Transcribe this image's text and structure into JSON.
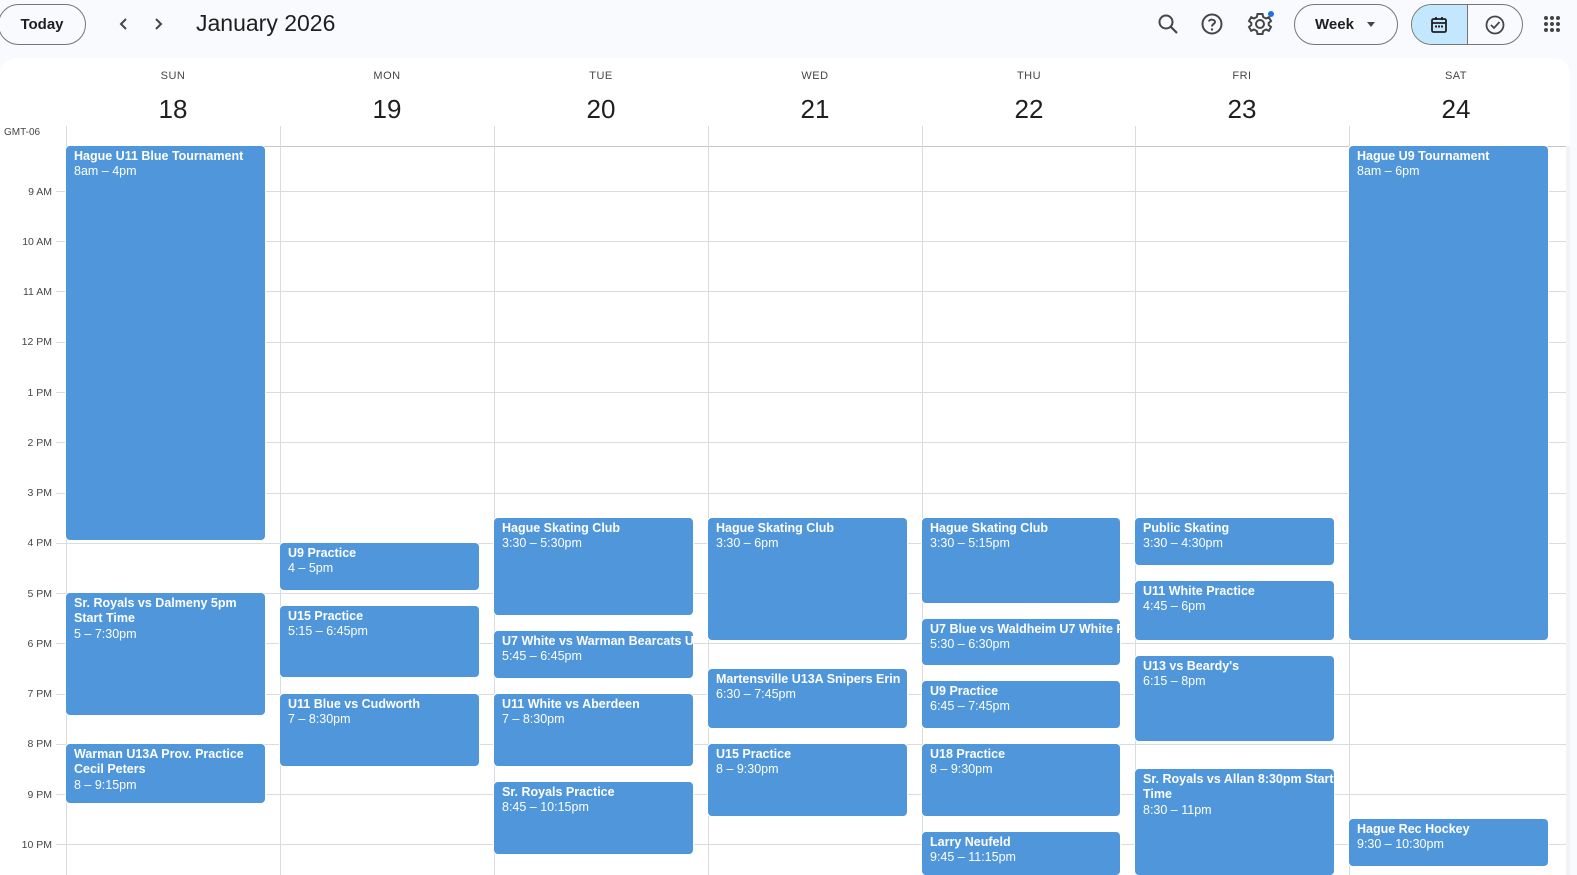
{
  "header": {
    "today_label": "Today",
    "title": "January 2026",
    "view_label": "Week",
    "icons": {
      "prev": "chevron-left-icon",
      "next": "chevron-right-icon",
      "search": "search-icon",
      "help": "help-icon",
      "settings": "gear-icon",
      "calendar": "calendar-icon",
      "tasks": "task-check-icon",
      "apps": "apps-grid-icon"
    }
  },
  "calendar": {
    "timezone": "GMT-06",
    "days": [
      {
        "dow": "SUN",
        "date": "18"
      },
      {
        "dow": "MON",
        "date": "19"
      },
      {
        "dow": "TUE",
        "date": "20"
      },
      {
        "dow": "WED",
        "date": "21"
      },
      {
        "dow": "THU",
        "date": "22"
      },
      {
        "dow": "FRI",
        "date": "23"
      },
      {
        "dow": "SAT",
        "date": "24"
      }
    ],
    "hours": [
      "9 AM",
      "10 AM",
      "11 AM",
      "12 PM",
      "1 PM",
      "2 PM",
      "3 PM",
      "4 PM",
      "5 PM",
      "6 PM",
      "7 PM",
      "8 PM",
      "9 PM",
      "10 PM"
    ],
    "event_color": "#4f96db",
    "events": [
      {
        "title": "Hague U11 Blue Tournament",
        "time": "8am – 4pm"
      },
      {
        "title": "Sr. Royals vs Dalmeny 5pm Start Time",
        "time": "5 – 7:30pm"
      },
      {
        "title": "Warman U13A Prov. Practice Cecil Peters",
        "time": "8 – 9:15pm"
      },
      {
        "title": "U9 Practice",
        "time": "4 – 5pm"
      },
      {
        "title": "U15 Practice",
        "time": "5:15 – 6:45pm"
      },
      {
        "title": "U11 Blue vs Cudworth",
        "time": "7 – 8:30pm"
      },
      {
        "title": "Hague Skating Club",
        "time": "3:30 – 5:30pm"
      },
      {
        "title": "U7 White vs Warman Bearcats U",
        "time": "5:45 – 6:45pm"
      },
      {
        "title": "U11 White vs Aberdeen",
        "time": "7 – 8:30pm"
      },
      {
        "title": "Sr. Royals Practice",
        "time": "8:45 – 10:15pm"
      },
      {
        "title": "Hague Skating Club",
        "time": "3:30 – 6pm"
      },
      {
        "title": "Martensville U13A Snipers Erin",
        "time": "6:30 – 7:45pm"
      },
      {
        "title": "U15 Practice",
        "time": "8 – 9:30pm"
      },
      {
        "title": "Hague Skating Club",
        "time": "3:30 – 5:15pm"
      },
      {
        "title": "U7 Blue vs Waldheim U7 White P",
        "time": "5:30 – 6:30pm"
      },
      {
        "title": "U9 Practice",
        "time": "6:45 – 7:45pm"
      },
      {
        "title": "U18 Practice",
        "time": "8 – 9:30pm"
      },
      {
        "title": "Larry Neufeld",
        "time": "9:45 – 11:15pm"
      },
      {
        "title": "Public Skating",
        "time": "3:30 – 4:30pm"
      },
      {
        "title": "U11 White Practice",
        "time": "4:45 – 6pm"
      },
      {
        "title": "U13 vs Beardy's",
        "time": "6:15 – 8pm"
      },
      {
        "title": "Sr. Royals vs Allan 8:30pm Start Time",
        "time": "8:30 – 11pm"
      },
      {
        "title": "Hague U9 Tournament",
        "time": "8am – 6pm"
      },
      {
        "title": "Hague Rec Hockey",
        "time": "9:30 – 10:30pm"
      }
    ]
  }
}
